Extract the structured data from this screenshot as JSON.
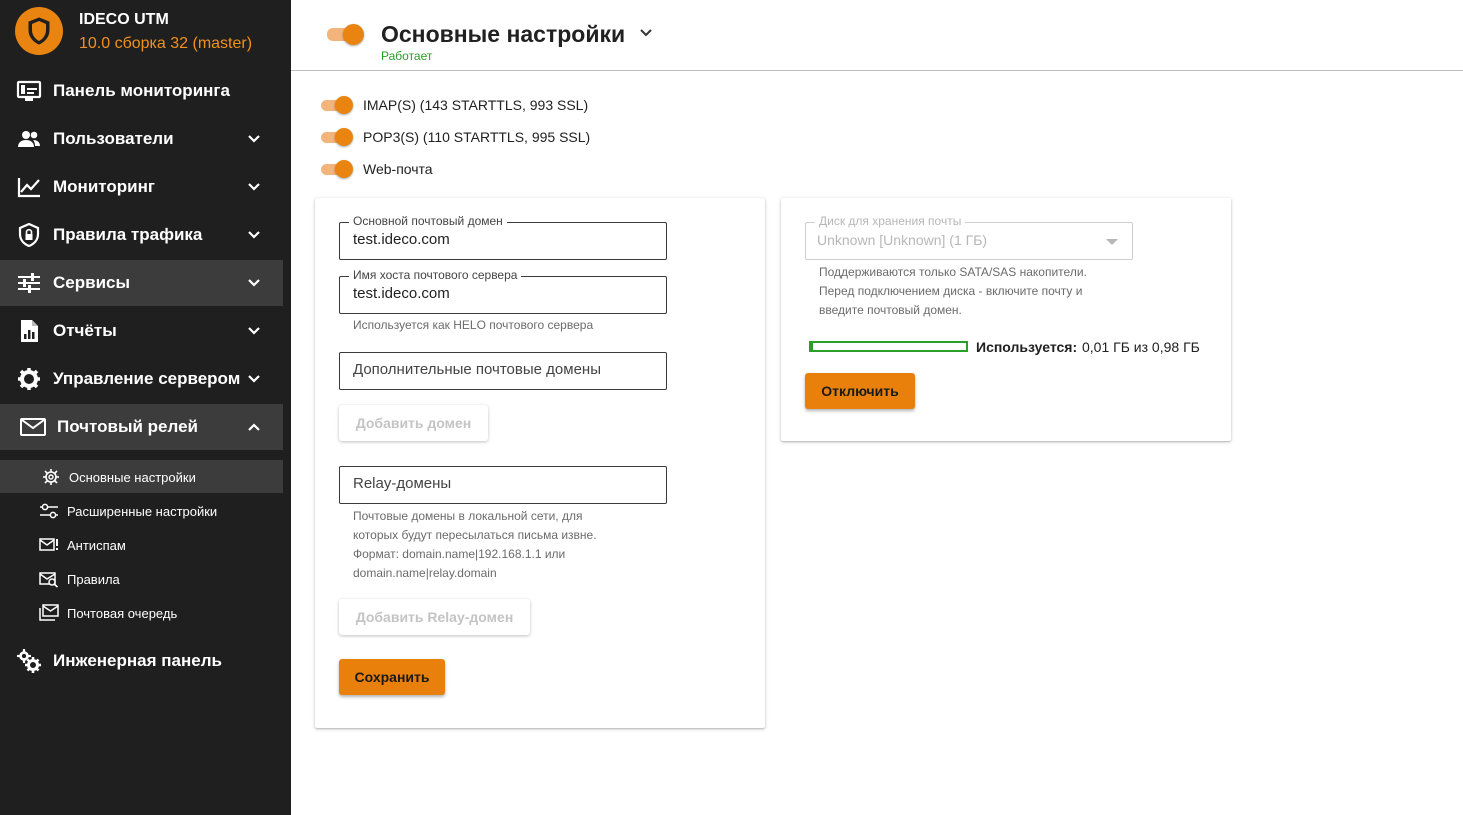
{
  "brand": {
    "name": "IDECO UTM",
    "version": "10.0 сборка 32 (master)"
  },
  "nav": {
    "items": [
      {
        "label": "Панель мониторинга",
        "icon": "monitor-icon"
      },
      {
        "label": "Пользователи",
        "icon": "users-icon"
      },
      {
        "label": "Мониторинг",
        "icon": "chart-line-icon"
      },
      {
        "label": "Правила трафика",
        "icon": "shield-lock-icon"
      },
      {
        "label": "Сервисы",
        "icon": "sliders-icon"
      },
      {
        "label": "Отчёты",
        "icon": "report-icon"
      },
      {
        "label": "Управление сервером",
        "icon": "gear-icon"
      },
      {
        "label": "Почтовый релей",
        "icon": "mail-icon"
      },
      {
        "label": "Инженерная панель",
        "icon": "gears-icon"
      }
    ],
    "mail_sub": [
      {
        "label": "Основные настройки",
        "icon": "settings-icon"
      },
      {
        "label": "Расширенные настройки",
        "icon": "tune-icon"
      },
      {
        "label": "Антиспам",
        "icon": "mail-alert-icon"
      },
      {
        "label": "Правила",
        "icon": "mail-search-icon"
      },
      {
        "label": "Почтовая очередь",
        "icon": "mail-queue-icon"
      }
    ]
  },
  "header": {
    "title": "Основные настройки",
    "status": "Работает",
    "enabled": true
  },
  "protocols": [
    {
      "label": "IMAP(S) (143 STARTTLS, 993 SSL)",
      "enabled": true
    },
    {
      "label": "POP3(S) (110 STARTTLS, 995 SSL)",
      "enabled": true
    },
    {
      "label": "Web-почта",
      "enabled": true
    }
  ],
  "form": {
    "main_domain_label": "Основной почтовый домен",
    "main_domain_value": "test.ideco.com",
    "hostname_label": "Имя хоста почтового сервера",
    "hostname_value": "test.ideco.com",
    "hostname_helper": "Используется как HELO почтового сервера",
    "extra_domains_placeholder": "Дополнительные почтовые домены",
    "add_domain_button": "Добавить домен",
    "relay_domains_placeholder": "Relay-домены",
    "relay_helper_1": "Почтовые домены в локальной сети, для",
    "relay_helper_2": "которых будут пересылаться письма извне.",
    "relay_helper_3": "Формат: domain.name|192.168.1.1 или",
    "relay_helper_4": "domain.name|relay.domain",
    "add_relay_button": "Добавить Relay-домен",
    "save_button": "Сохранить"
  },
  "storage": {
    "disk_label": "Диск для хранения почты",
    "disk_value": "Unknown [Unknown] (1 ГБ)",
    "helper_1": "Поддерживаются только SATA/SAS накопители.",
    "helper_2": "Перед подключением диска - включите почту и",
    "helper_3": "введите почтовый домен.",
    "usage_label": "Используется:",
    "usage_value": "0,01 ГБ из 0,98 ГБ",
    "usage_fraction": 0.0102,
    "disable_button": "Отключить"
  },
  "colors": {
    "accent": "#e8840f",
    "status_ok": "#2a9b2a",
    "sidebar_bg": "#1f1f1f"
  }
}
